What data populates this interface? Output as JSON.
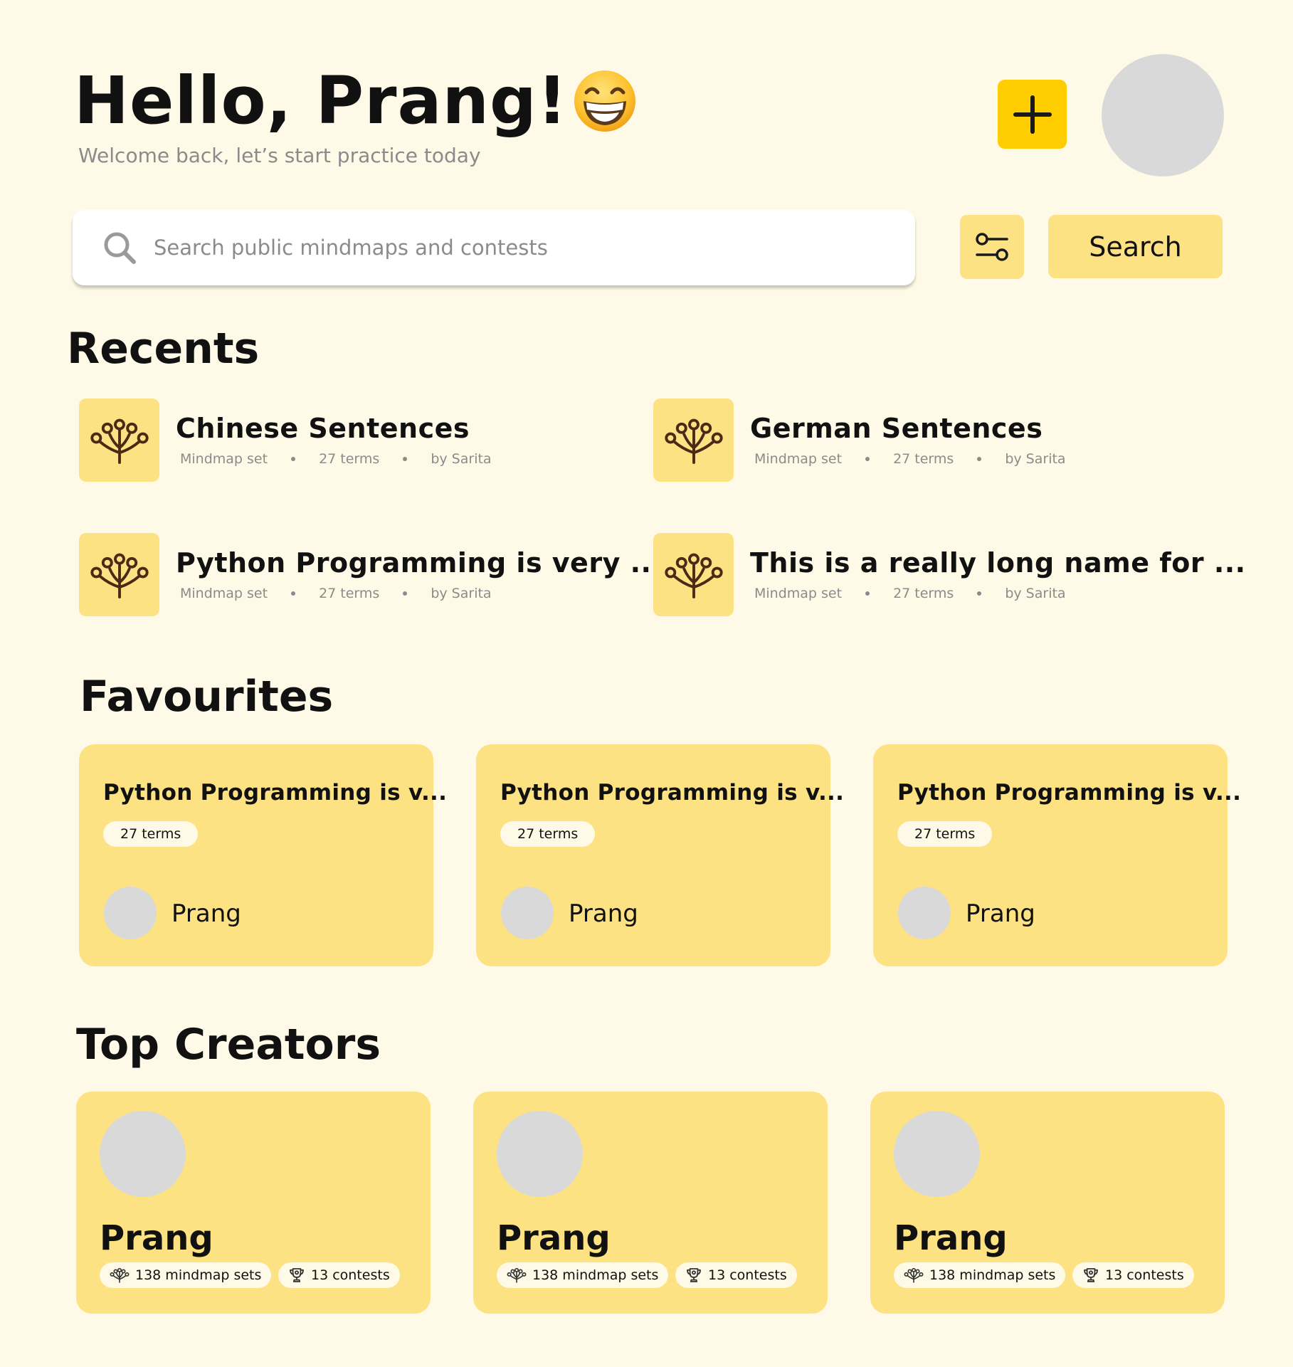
{
  "header": {
    "greeting": "Hello, Prang!",
    "emoji": "grinning-face-icon",
    "subtitle": "Welcome back, let’s start practice today",
    "add_icon": "plus-icon",
    "avatar": "avatar"
  },
  "search": {
    "placeholder": "Search public mindmaps and contests",
    "value": "",
    "filter_icon": "filter-sliders-icon",
    "button_label": "Search"
  },
  "recents": {
    "title": "Recents",
    "items": [
      {
        "title": "Chinese Sentences",
        "type": "Mindmap set",
        "terms": "27 terms",
        "author": "by Sarita",
        "icon": "mindmap-tree-icon"
      },
      {
        "title": "German Sentences",
        "type": "Mindmap set",
        "terms": "27 terms",
        "author": "by Sarita",
        "icon": "mindmap-tree-icon"
      },
      {
        "title": "Python Programming is very ...",
        "type": "Mindmap set",
        "terms": "27 terms",
        "author": "by Sarita",
        "icon": "mindmap-tree-icon"
      },
      {
        "title": "This is a really long name for ...",
        "type": "Mindmap set",
        "terms": "27 terms",
        "author": "by Sarita",
        "icon": "mindmap-tree-icon"
      }
    ]
  },
  "favourites": {
    "title": "Favourites",
    "cards": [
      {
        "title": "Python Programming is v...",
        "terms": "27 terms",
        "author": "Prang"
      },
      {
        "title": "Python Programming is v...",
        "terms": "27 terms",
        "author": "Prang"
      },
      {
        "title": "Python Programming is v...",
        "terms": "27 terms",
        "author": "Prang"
      }
    ]
  },
  "top_creators": {
    "title": "Top Creators",
    "cards": [
      {
        "name": "Prang",
        "mindmaps": "138 mindmap sets",
        "contests": "13 contests"
      },
      {
        "name": "Prang",
        "mindmaps": "138 mindmap sets",
        "contests": "13 contests"
      },
      {
        "name": "Prang",
        "mindmaps": "138 mindmap sets",
        "contests": "13 contests"
      }
    ]
  },
  "colors": {
    "background": "#FEFAE7",
    "accent": "#FFCE00",
    "card": "#FDE283",
    "icon_brown": "#4A2A14",
    "muted_text": "#8B8B8B",
    "avatar_placeholder": "#D9D9D9"
  }
}
